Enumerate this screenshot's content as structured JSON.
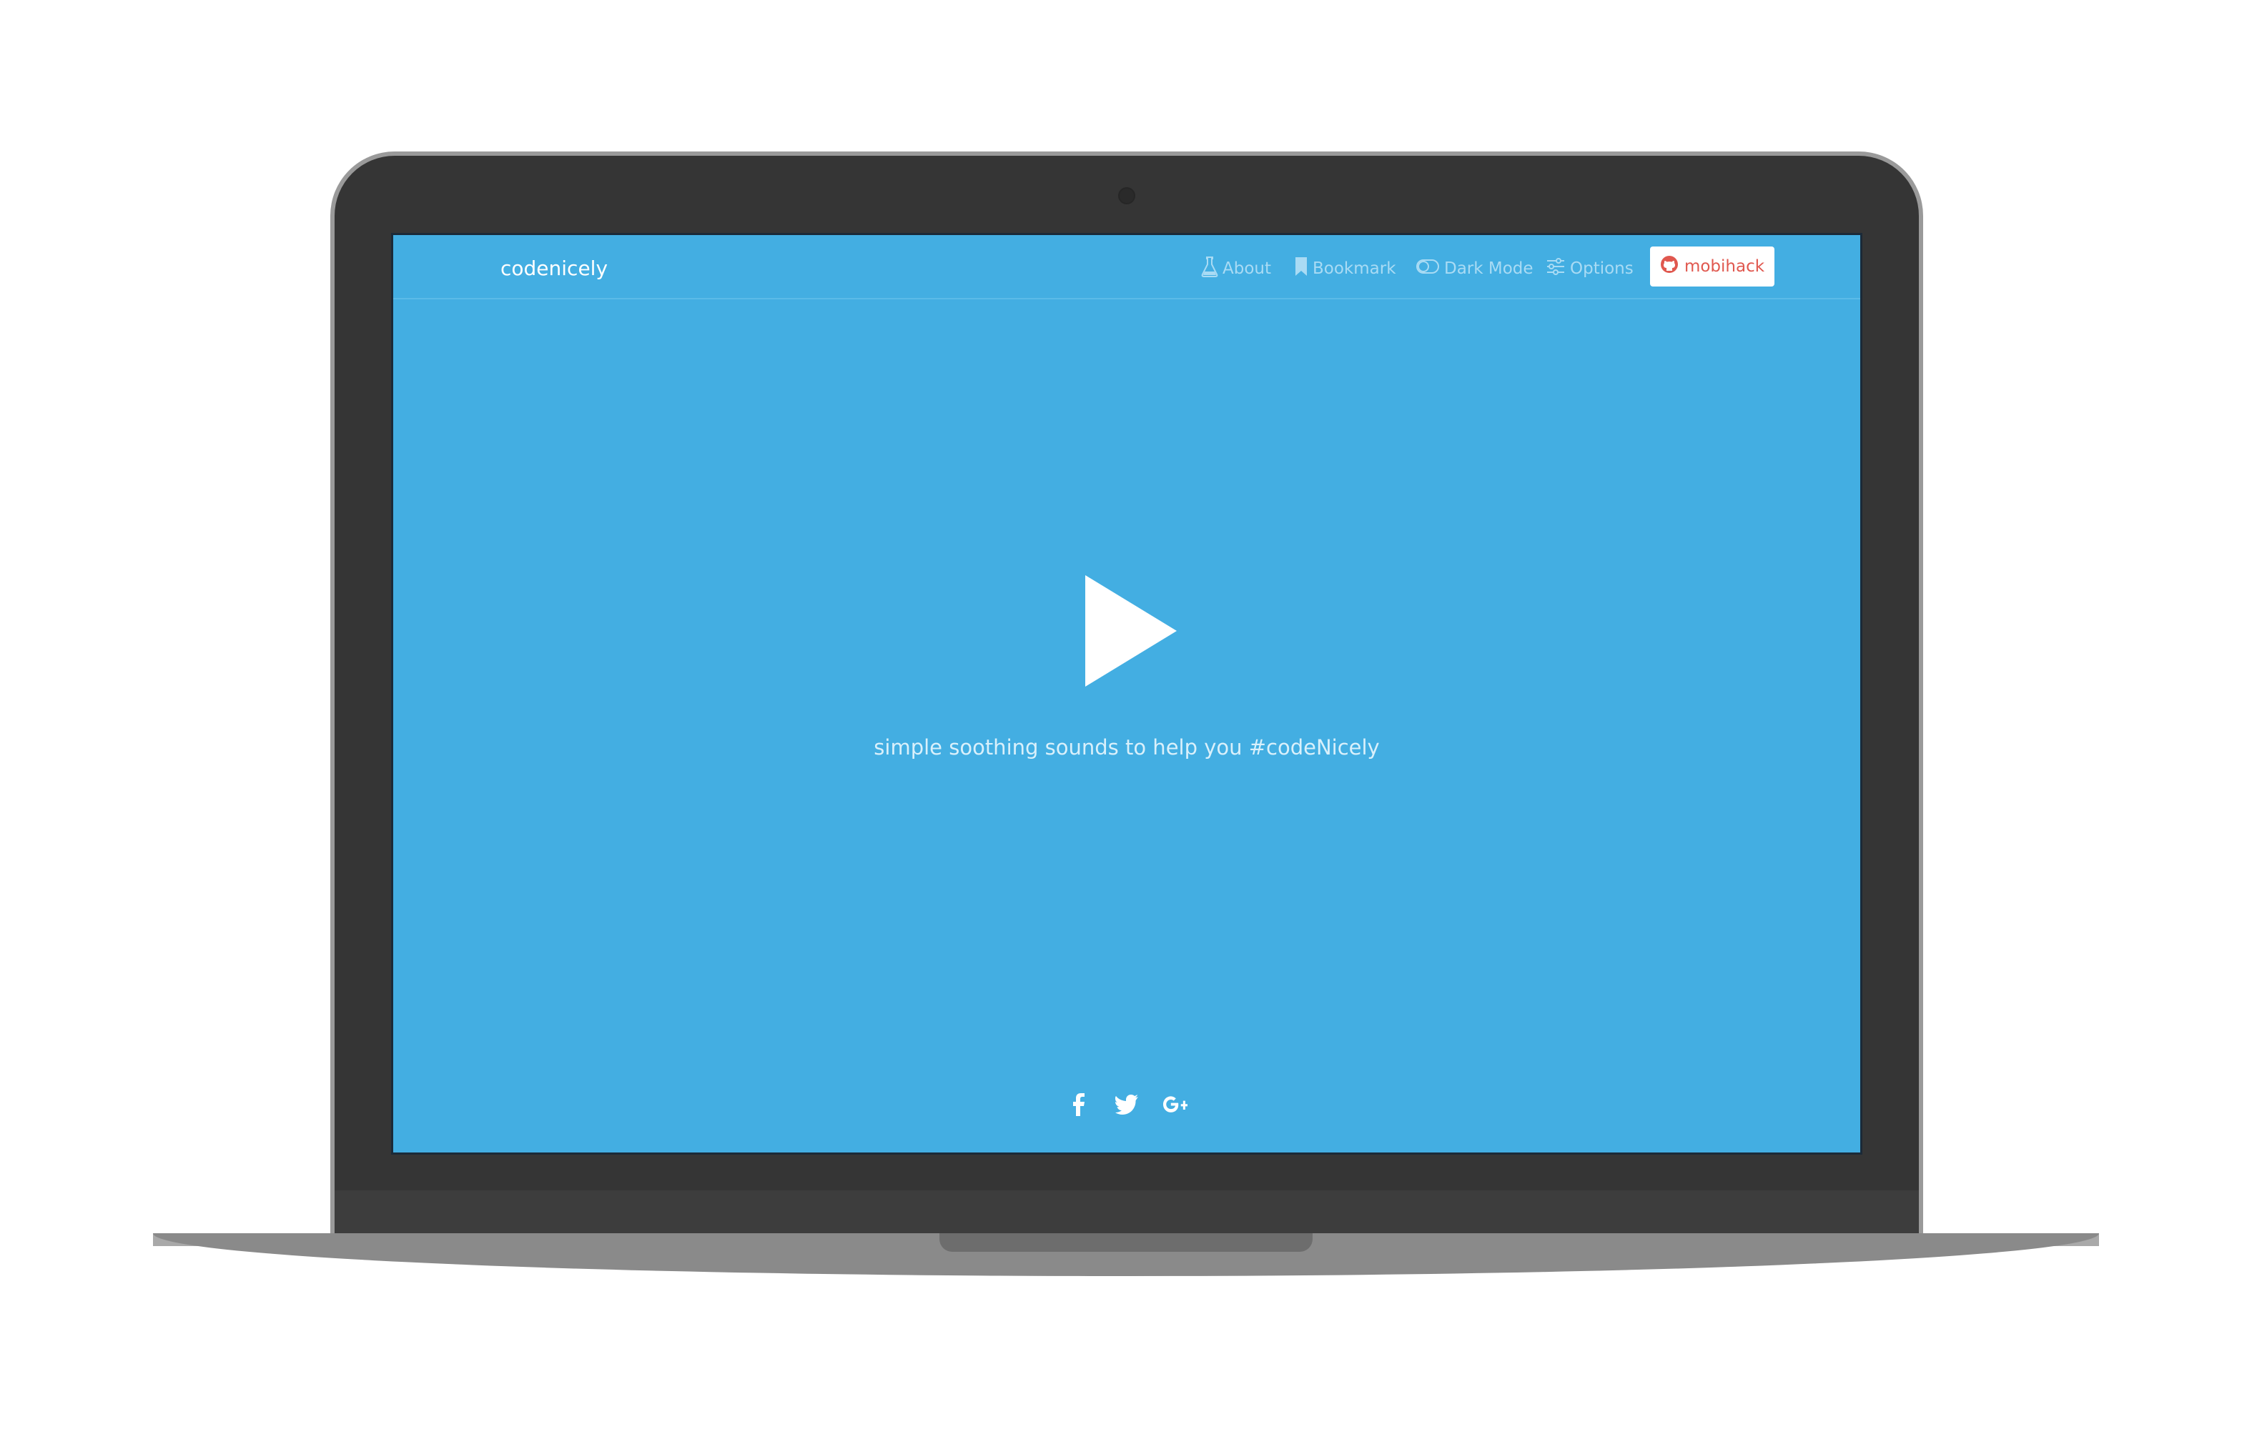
{
  "app": {
    "brand": "codenicely"
  },
  "nav": {
    "items": [
      {
        "label": "About",
        "icon": "flask-icon"
      },
      {
        "label": "Bookmark",
        "icon": "bookmark-icon"
      },
      {
        "label": "Dark Mode",
        "icon": "toggle-icon"
      },
      {
        "label": "Options",
        "icon": "sliders-icon"
      }
    ],
    "github_button": {
      "label": "mobihack",
      "icon": "github-icon"
    }
  },
  "main": {
    "play_icon": "play-icon",
    "tagline": "simple soothing sounds to help you #codeNicely"
  },
  "social": [
    "facebook-icon",
    "twitter-icon",
    "google-plus-icon"
  ],
  "colors": {
    "screen_background": "#43aee2",
    "nav_text": "#a9dbf4",
    "github_text": "#e0584f",
    "bezel": "#353535"
  }
}
